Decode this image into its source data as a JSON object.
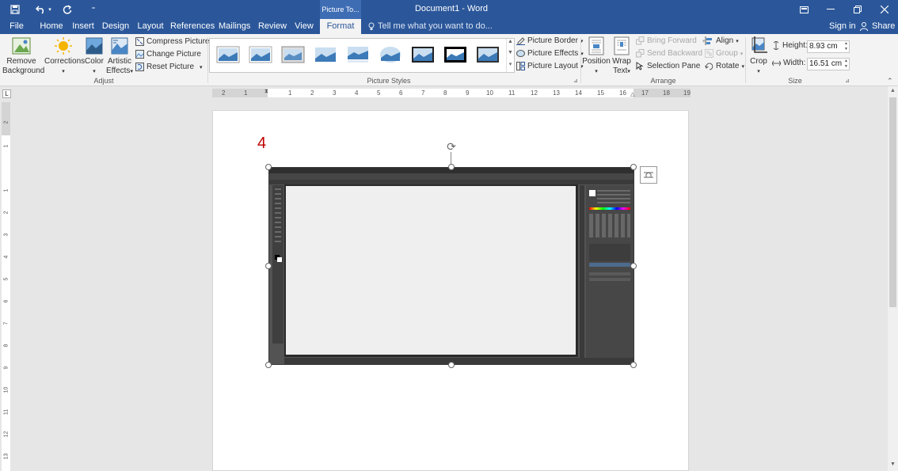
{
  "titlebar": {
    "doc_title": "Document1 - Word",
    "context_tab": "Picture To..."
  },
  "tabs": {
    "file": "File",
    "home": "Home",
    "insert": "Insert",
    "design": "Design",
    "layout": "Layout",
    "references": "References",
    "mailings": "Mailings",
    "review": "Review",
    "view": "View",
    "format": "Format"
  },
  "tellme": "Tell me what you want to do...",
  "signin": "Sign in",
  "share": "Share",
  "ribbon": {
    "remove_bg_1": "Remove",
    "remove_bg_2": "Background",
    "corrections": "Corrections",
    "color": "Color",
    "artistic_1": "Artistic",
    "artistic_2": "Effects",
    "compress": "Compress Pictures",
    "change": "Change Picture",
    "reset": "Reset Picture",
    "adjust_label": "Adjust",
    "styles_label": "Picture Styles",
    "border": "Picture Border",
    "effects": "Picture Effects",
    "layout": "Picture Layout",
    "position": "Position",
    "wrap_1": "Wrap",
    "wrap_2": "Text",
    "bring_forward": "Bring Forward",
    "send_backward": "Send Backward",
    "selection_pane": "Selection Pane",
    "align": "Align",
    "group": "Group",
    "rotate": "Rotate",
    "arrange_label": "Arrange",
    "crop": "Crop",
    "height_label": "Height:",
    "height_value": "8.93 cm",
    "width_label": "Width:",
    "width_value": "16.51 cm",
    "size_label": "Size"
  },
  "ruler_h": [
    "2",
    "1",
    "1",
    "1",
    "2",
    "3",
    "4",
    "5",
    "6",
    "7",
    "8",
    "9",
    "10",
    "11",
    "12",
    "13",
    "14",
    "15",
    "16",
    "17",
    "18",
    "19"
  ],
  "ruler_v": [
    "2",
    "1",
    "1",
    "1",
    "2",
    "3",
    "4",
    "5",
    "6",
    "7",
    "8",
    "9",
    "10",
    "11",
    "12",
    "13"
  ],
  "document": {
    "step_number": "4"
  }
}
